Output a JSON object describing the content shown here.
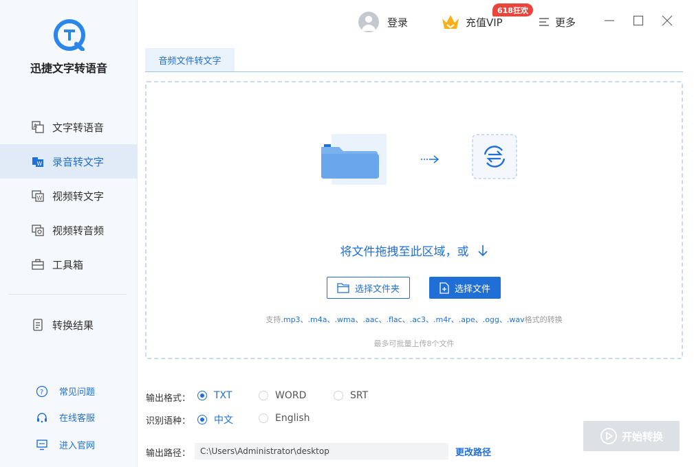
{
  "app": {
    "name": "迅捷文字转语音"
  },
  "sidebar": {
    "items": [
      {
        "label": "文字转语音"
      },
      {
        "label": "录音转文字"
      },
      {
        "label": "视频转文字"
      },
      {
        "label": "视频转音频"
      },
      {
        "label": "工具箱"
      },
      {
        "label": "转换结果"
      }
    ],
    "footer": [
      {
        "label": "常见问题"
      },
      {
        "label": "在线客服"
      },
      {
        "label": "进入官网"
      }
    ]
  },
  "topbar": {
    "login": "登录",
    "vip": "充值VIP",
    "vip_badge": "618狂欢",
    "more": "更多"
  },
  "tab": {
    "label": "音频文件转文字"
  },
  "dropzone": {
    "drop_text": "将文件拖拽至此区域，或",
    "choose_folder": "选择文件夹",
    "choose_file": "选择文件",
    "support_prefix": "支持",
    "support_formats": ".mp3、.m4a、.wma、.aac、.flac、.ac3、.m4r、.ape、.ogg、.wav",
    "support_suffix": "格式的转换",
    "batch_limit": "最多可批量上传8个文件"
  },
  "options": {
    "format_label": "输出格式：",
    "formats": [
      "TXT",
      "WORD",
      "SRT"
    ],
    "language_label": "识别语种：",
    "languages": [
      "中文",
      "English"
    ],
    "path_label": "输出路径：",
    "path_value": "C:\\Users\\Administrator\\desktop",
    "change_path": "更改路径",
    "start": "开始转换"
  },
  "colors": {
    "accent": "#1f6fd6",
    "badge": "#e8453c",
    "sidebar_bg": "#f5f8fc"
  }
}
